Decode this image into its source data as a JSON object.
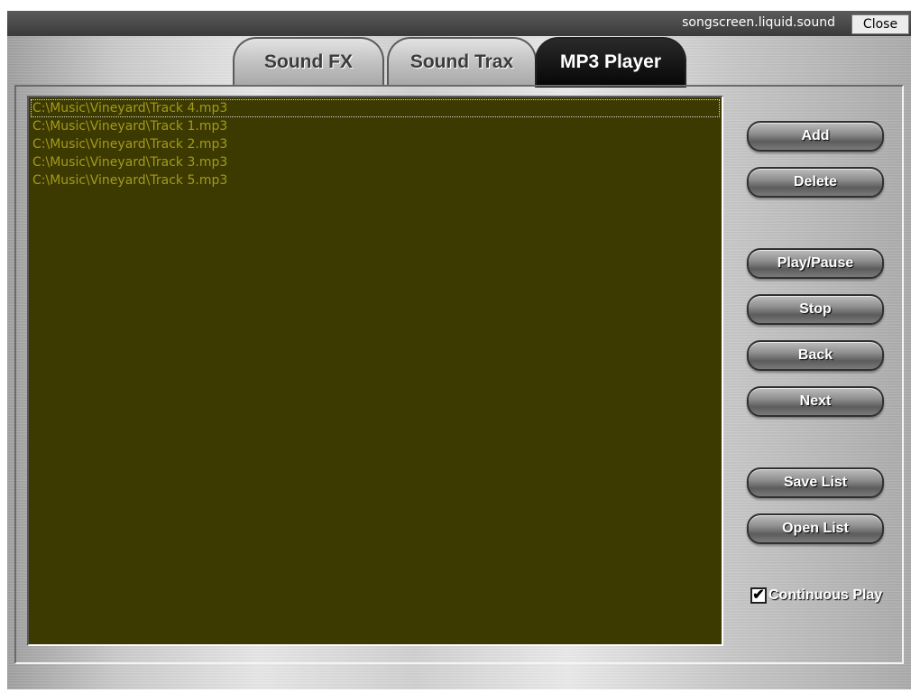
{
  "window": {
    "title": "songscreen.liquid.sound",
    "close_label": "Close"
  },
  "tabs": [
    {
      "label": "Sound FX",
      "active": false
    },
    {
      "label": "Sound Trax",
      "active": false
    },
    {
      "label": "MP3 Player",
      "active": true
    }
  ],
  "playlist": {
    "tracks": [
      "C:\\Music\\Vineyard\\Track  4.mp3",
      "C:\\Music\\Vineyard\\Track  1.mp3",
      "C:\\Music\\Vineyard\\Track  2.mp3",
      "C:\\Music\\Vineyard\\Track  3.mp3",
      "C:\\Music\\Vineyard\\Track  5.mp3"
    ],
    "selected_index": 0
  },
  "controls": {
    "add": "Add",
    "delete": "Delete",
    "play_pause": "Play/Pause",
    "stop": "Stop",
    "back": "Back",
    "next": "Next",
    "save_list": "Save List",
    "open_list": "Open List",
    "continuous_play": "Continuous Play",
    "continuous_play_checked": true
  },
  "colors": {
    "playlist_bg": "#3c3a00",
    "track_text": "#a39a1b",
    "titlebar": "#4a4a4a"
  }
}
